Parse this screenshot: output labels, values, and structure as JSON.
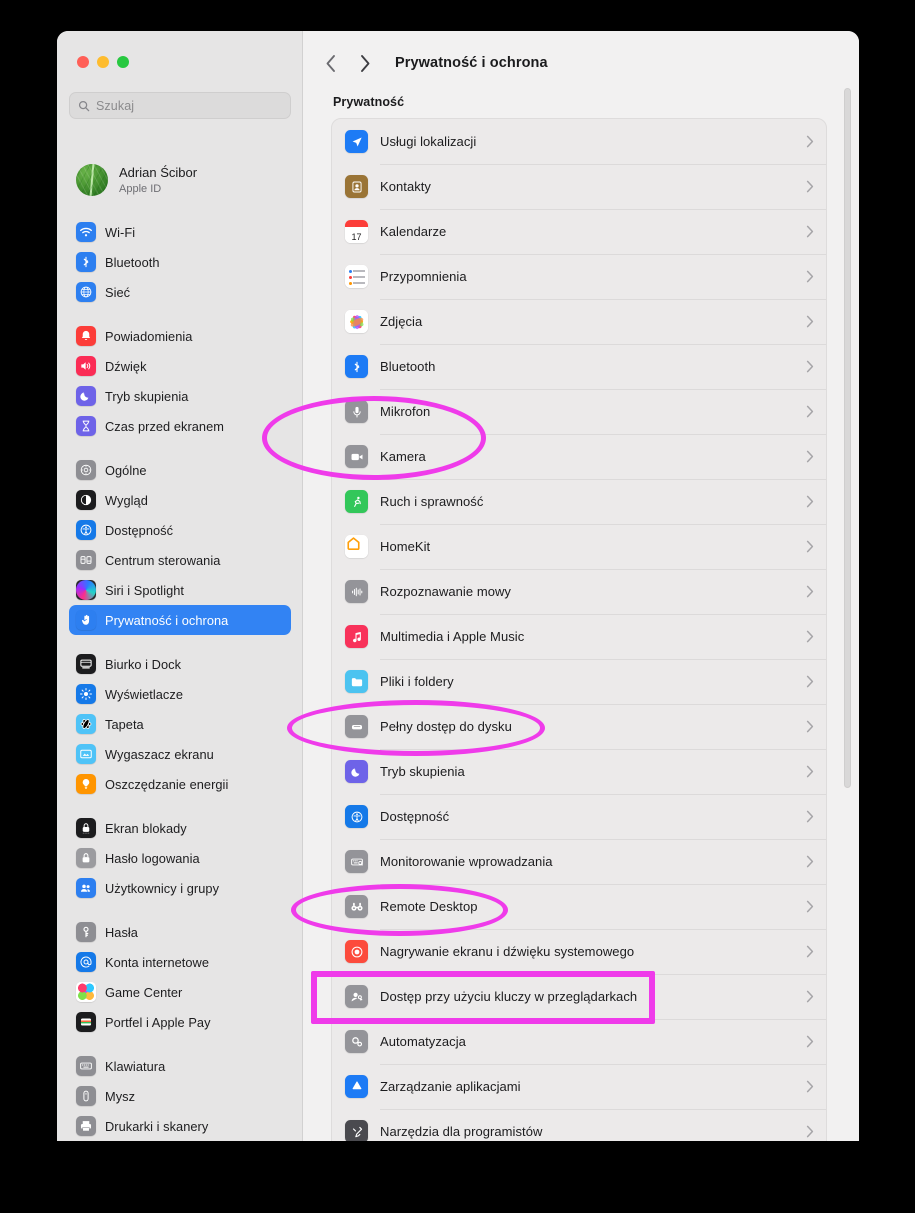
{
  "window": {
    "traffic_lights": [
      "close",
      "minimize",
      "zoom"
    ],
    "colors": {
      "red": "#ff5f57",
      "yellow": "#febc2e",
      "green": "#28c840",
      "accent": "#3283f3",
      "annotation": "#ef3bea"
    }
  },
  "sidebar": {
    "search": {
      "placeholder": "Szukaj",
      "icon": "search-icon"
    },
    "account": {
      "name": "Adrian Ścibor",
      "subtitle": "Apple ID",
      "avatar": "leaf-photo-avatar"
    },
    "groups": [
      {
        "items": [
          {
            "label": "Wi-Fi",
            "icon": "wifi-icon",
            "color": "#2d7ff0",
            "selected": false
          },
          {
            "label": "Bluetooth",
            "icon": "bluetooth-icon",
            "color": "#2d7ff0",
            "selected": false
          },
          {
            "label": "Sieć",
            "icon": "globe-icon",
            "color": "#2d7ff0",
            "selected": false
          }
        ]
      },
      {
        "items": [
          {
            "label": "Powiadomienia",
            "icon": "bell-icon",
            "color": "#fc3d39",
            "selected": false
          },
          {
            "label": "Dźwięk",
            "icon": "speaker-icon",
            "color": "#fb2c55",
            "selected": false
          },
          {
            "label": "Tryb skupienia",
            "icon": "moon-icon",
            "color": "#6e63e8",
            "selected": false
          },
          {
            "label": "Czas przed ekranem",
            "icon": "hourglass-icon",
            "color": "#6e63e8",
            "selected": false
          }
        ]
      },
      {
        "items": [
          {
            "label": "Ogólne",
            "icon": "gear-icon",
            "color": "#8e8e93",
            "selected": false
          },
          {
            "label": "Wygląd",
            "icon": "appearance-icon",
            "color": "#1c1c1e",
            "selected": false
          },
          {
            "label": "Dostępność",
            "icon": "accessibility-icon",
            "color": "#1579e8",
            "selected": false
          },
          {
            "label": "Centrum sterowania",
            "icon": "control-center-icon",
            "color": "#8e8e93",
            "selected": false
          },
          {
            "label": "Siri i Spotlight",
            "icon": "siri-icon",
            "color": "#2b2b30",
            "selected": false
          },
          {
            "label": "Prywatność i ochrona",
            "icon": "hand-raised-icon",
            "color": "#2d7ff0",
            "selected": true
          }
        ]
      },
      {
        "items": [
          {
            "label": "Biurko i Dock",
            "icon": "desktop-dock-icon",
            "color": "#1c1c1e",
            "selected": false
          },
          {
            "label": "Wyświetlacze",
            "icon": "display-icon",
            "color": "#1579e8",
            "selected": false
          },
          {
            "label": "Tapeta",
            "icon": "wallpaper-icon",
            "color": "#4fc3f7",
            "selected": false
          },
          {
            "label": "Wygaszacz ekranu",
            "icon": "screensaver-icon",
            "color": "#4fc3f7",
            "selected": false
          },
          {
            "label": "Oszczędzanie energii",
            "icon": "lightbulb-icon",
            "color": "#ff9500",
            "selected": false
          }
        ]
      },
      {
        "items": [
          {
            "label": "Ekran blokady",
            "icon": "lock-screen-icon",
            "color": "#1c1c1e",
            "selected": false
          },
          {
            "label": "Hasło logowania",
            "icon": "padlock-icon",
            "color": "#9b9b9f",
            "selected": false
          },
          {
            "label": "Użytkownicy i grupy",
            "icon": "users-icon",
            "color": "#2d7ff0",
            "selected": false
          }
        ]
      },
      {
        "items": [
          {
            "label": "Hasła",
            "icon": "key-icon",
            "color": "#8e8e93",
            "selected": false
          },
          {
            "label": "Konta internetowe",
            "icon": "at-sign-icon",
            "color": "#1579e8",
            "selected": false
          },
          {
            "label": "Game Center",
            "icon": "game-center-icon",
            "color": "#ffffff",
            "selected": false
          },
          {
            "label": "Portfel i Apple Pay",
            "icon": "wallet-icon",
            "color": "#1c1c1e",
            "selected": false
          }
        ]
      },
      {
        "items": [
          {
            "label": "Klawiatura",
            "icon": "keyboard-icon",
            "color": "#8e8e93",
            "selected": false
          },
          {
            "label": "Mysz",
            "icon": "mouse-icon",
            "color": "#8e8e93",
            "selected": false
          },
          {
            "label": "Drukarki i skanery",
            "icon": "printer-icon",
            "color": "#8e8e93",
            "selected": false
          }
        ]
      }
    ]
  },
  "content": {
    "back_icon": "chevron-left-icon",
    "forward_icon": "chevron-right-icon",
    "title": "Prywatność i ochrona",
    "section_title": "Prywatność",
    "rows": [
      {
        "label": "Usługi lokalizacji",
        "icon": "location-arrow-icon",
        "color": "#1d7bf5"
      },
      {
        "label": "Kontakty",
        "icon": "contacts-icon",
        "color": "#9a7436"
      },
      {
        "label": "Kalendarze",
        "icon": "calendar-icon",
        "color": "#ffffff"
      },
      {
        "label": "Przypomnienia",
        "icon": "reminders-icon",
        "color": "#ffffff"
      },
      {
        "label": "Zdjęcia",
        "icon": "photos-icon",
        "color": "#ffffff"
      },
      {
        "label": "Bluetooth",
        "icon": "bluetooth-icon",
        "color": "#1d7bf5"
      },
      {
        "label": "Mikrofon",
        "icon": "microphone-icon",
        "color": "#949499"
      },
      {
        "label": "Kamera",
        "icon": "camera-icon",
        "color": "#949499"
      },
      {
        "label": "Ruch i sprawność",
        "icon": "motion-fitness-icon",
        "color": "#33c75a"
      },
      {
        "label": "HomeKit",
        "icon": "homekit-icon",
        "color": "#ffffff"
      },
      {
        "label": "Rozpoznawanie mowy",
        "icon": "speech-recognition-icon",
        "color": "#949499"
      },
      {
        "label": "Multimedia i Apple Music",
        "icon": "apple-music-icon",
        "color": "#f8325a"
      },
      {
        "label": "Pliki i foldery",
        "icon": "files-folders-icon",
        "color": "#4cc3f0"
      },
      {
        "label": "Pełny dostęp do dysku",
        "icon": "hard-drive-icon",
        "color": "#949499"
      },
      {
        "label": "Tryb skupienia",
        "icon": "moon-icon",
        "color": "#6e63e8"
      },
      {
        "label": "Dostępność",
        "icon": "accessibility-icon",
        "color": "#1579e8"
      },
      {
        "label": "Monitorowanie wprowadzania",
        "icon": "input-monitoring-icon",
        "color": "#949499"
      },
      {
        "label": "Remote Desktop",
        "icon": "binoculars-icon",
        "color": "#949499"
      },
      {
        "label": "Nagrywanie ekranu i dźwięku systemowego",
        "icon": "screen-recording-icon",
        "color": "#fc4b3c"
      },
      {
        "label": "Dostęp przy użyciu kluczy w przeglądarkach",
        "icon": "passkey-access-icon",
        "color": "#949499"
      },
      {
        "label": "Automatyzacja",
        "icon": "automation-icon",
        "color": "#949499"
      },
      {
        "label": "Zarządzanie aplikacjami",
        "icon": "app-management-icon",
        "color": "#1d7bf5"
      },
      {
        "label": "Narzędzia dla programistów",
        "icon": "developer-tools-icon",
        "color": "#4a4a4f"
      }
    ]
  },
  "annotations": [
    {
      "name": "highlight-microphone-camera",
      "shape": "ellipse"
    },
    {
      "name": "highlight-full-disk-access",
      "shape": "ellipse"
    },
    {
      "name": "highlight-remote-desktop",
      "shape": "ellipse"
    },
    {
      "name": "highlight-passkey-access",
      "shape": "rectangle"
    }
  ]
}
